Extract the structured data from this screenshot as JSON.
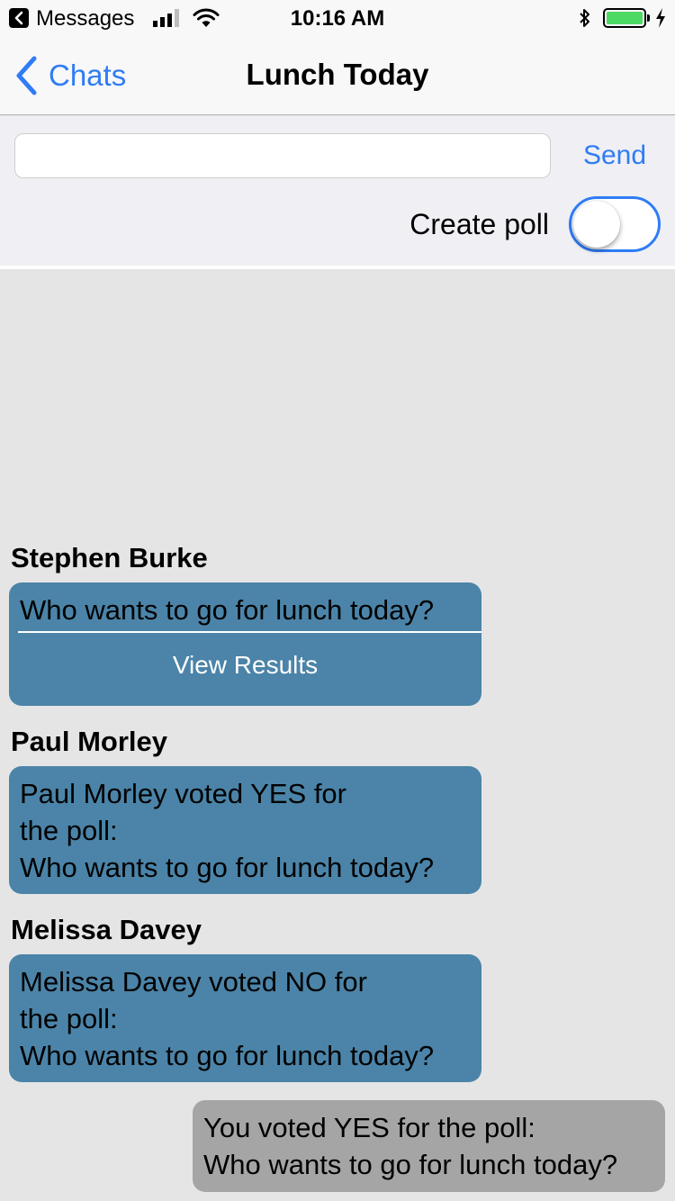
{
  "status_bar": {
    "back_app": "Messages",
    "time": "10:16 AM",
    "battery_level": 1.0
  },
  "nav": {
    "back_label": "Chats",
    "title": "Lunch Today"
  },
  "composer": {
    "input_value": "",
    "input_placeholder": "",
    "send_label": "Send",
    "poll_label": "Create poll",
    "poll_on": false
  },
  "colors": {
    "accent": "#2f7cf6",
    "incoming_bubble": "#4b84a8",
    "outgoing_bubble": "#a5a5a5",
    "background": "#e5e5e5"
  },
  "messages": [
    {
      "sender": "Stephen Burke",
      "type": "poll",
      "question": "Who wants to go for lunch today?",
      "action": "View Results"
    },
    {
      "sender": "Paul Morley",
      "type": "vote",
      "text": "Paul Morley voted YES for\nthe poll:\nWho wants to go for lunch today?"
    },
    {
      "sender": "Melissa Davey",
      "type": "vote",
      "text": "Melissa Davey voted NO for\nthe poll:\nWho wants to go for lunch today?"
    },
    {
      "sender": "",
      "type": "own",
      "text": "You voted YES for the poll:\nWho wants to go for lunch today?"
    }
  ]
}
